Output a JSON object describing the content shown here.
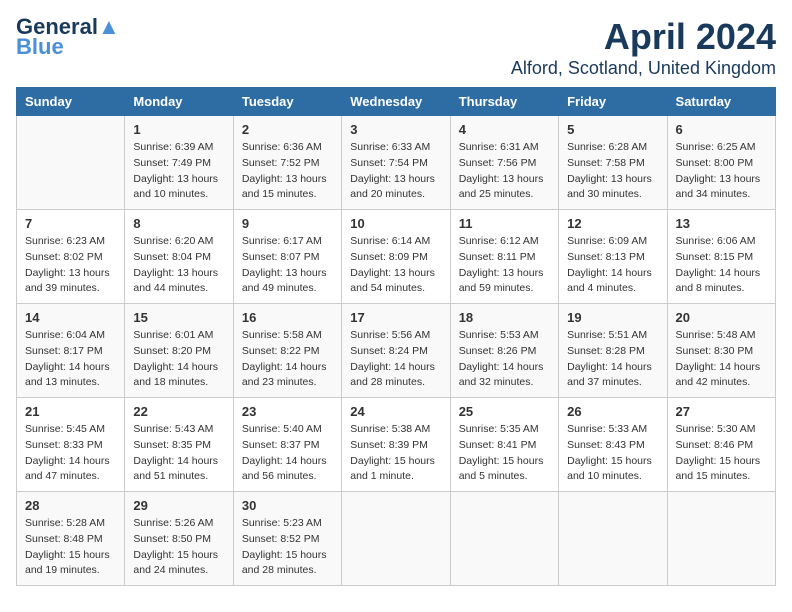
{
  "header": {
    "logo_line1": "General",
    "logo_line2": "Blue",
    "month_year": "April 2024",
    "location": "Alford, Scotland, United Kingdom"
  },
  "weekdays": [
    "Sunday",
    "Monday",
    "Tuesday",
    "Wednesday",
    "Thursday",
    "Friday",
    "Saturday"
  ],
  "weeks": [
    [
      {
        "day": "",
        "sunrise": "",
        "sunset": "",
        "daylight": ""
      },
      {
        "day": "1",
        "sunrise": "Sunrise: 6:39 AM",
        "sunset": "Sunset: 7:49 PM",
        "daylight": "Daylight: 13 hours and 10 minutes."
      },
      {
        "day": "2",
        "sunrise": "Sunrise: 6:36 AM",
        "sunset": "Sunset: 7:52 PM",
        "daylight": "Daylight: 13 hours and 15 minutes."
      },
      {
        "day": "3",
        "sunrise": "Sunrise: 6:33 AM",
        "sunset": "Sunset: 7:54 PM",
        "daylight": "Daylight: 13 hours and 20 minutes."
      },
      {
        "day": "4",
        "sunrise": "Sunrise: 6:31 AM",
        "sunset": "Sunset: 7:56 PM",
        "daylight": "Daylight: 13 hours and 25 minutes."
      },
      {
        "day": "5",
        "sunrise": "Sunrise: 6:28 AM",
        "sunset": "Sunset: 7:58 PM",
        "daylight": "Daylight: 13 hours and 30 minutes."
      },
      {
        "day": "6",
        "sunrise": "Sunrise: 6:25 AM",
        "sunset": "Sunset: 8:00 PM",
        "daylight": "Daylight: 13 hours and 34 minutes."
      }
    ],
    [
      {
        "day": "7",
        "sunrise": "Sunrise: 6:23 AM",
        "sunset": "Sunset: 8:02 PM",
        "daylight": "Daylight: 13 hours and 39 minutes."
      },
      {
        "day": "8",
        "sunrise": "Sunrise: 6:20 AM",
        "sunset": "Sunset: 8:04 PM",
        "daylight": "Daylight: 13 hours and 44 minutes."
      },
      {
        "day": "9",
        "sunrise": "Sunrise: 6:17 AM",
        "sunset": "Sunset: 8:07 PM",
        "daylight": "Daylight: 13 hours and 49 minutes."
      },
      {
        "day": "10",
        "sunrise": "Sunrise: 6:14 AM",
        "sunset": "Sunset: 8:09 PM",
        "daylight": "Daylight: 13 hours and 54 minutes."
      },
      {
        "day": "11",
        "sunrise": "Sunrise: 6:12 AM",
        "sunset": "Sunset: 8:11 PM",
        "daylight": "Daylight: 13 hours and 59 minutes."
      },
      {
        "day": "12",
        "sunrise": "Sunrise: 6:09 AM",
        "sunset": "Sunset: 8:13 PM",
        "daylight": "Daylight: 14 hours and 4 minutes."
      },
      {
        "day": "13",
        "sunrise": "Sunrise: 6:06 AM",
        "sunset": "Sunset: 8:15 PM",
        "daylight": "Daylight: 14 hours and 8 minutes."
      }
    ],
    [
      {
        "day": "14",
        "sunrise": "Sunrise: 6:04 AM",
        "sunset": "Sunset: 8:17 PM",
        "daylight": "Daylight: 14 hours and 13 minutes."
      },
      {
        "day": "15",
        "sunrise": "Sunrise: 6:01 AM",
        "sunset": "Sunset: 8:20 PM",
        "daylight": "Daylight: 14 hours and 18 minutes."
      },
      {
        "day": "16",
        "sunrise": "Sunrise: 5:58 AM",
        "sunset": "Sunset: 8:22 PM",
        "daylight": "Daylight: 14 hours and 23 minutes."
      },
      {
        "day": "17",
        "sunrise": "Sunrise: 5:56 AM",
        "sunset": "Sunset: 8:24 PM",
        "daylight": "Daylight: 14 hours and 28 minutes."
      },
      {
        "day": "18",
        "sunrise": "Sunrise: 5:53 AM",
        "sunset": "Sunset: 8:26 PM",
        "daylight": "Daylight: 14 hours and 32 minutes."
      },
      {
        "day": "19",
        "sunrise": "Sunrise: 5:51 AM",
        "sunset": "Sunset: 8:28 PM",
        "daylight": "Daylight: 14 hours and 37 minutes."
      },
      {
        "day": "20",
        "sunrise": "Sunrise: 5:48 AM",
        "sunset": "Sunset: 8:30 PM",
        "daylight": "Daylight: 14 hours and 42 minutes."
      }
    ],
    [
      {
        "day": "21",
        "sunrise": "Sunrise: 5:45 AM",
        "sunset": "Sunset: 8:33 PM",
        "daylight": "Daylight: 14 hours and 47 minutes."
      },
      {
        "day": "22",
        "sunrise": "Sunrise: 5:43 AM",
        "sunset": "Sunset: 8:35 PM",
        "daylight": "Daylight: 14 hours and 51 minutes."
      },
      {
        "day": "23",
        "sunrise": "Sunrise: 5:40 AM",
        "sunset": "Sunset: 8:37 PM",
        "daylight": "Daylight: 14 hours and 56 minutes."
      },
      {
        "day": "24",
        "sunrise": "Sunrise: 5:38 AM",
        "sunset": "Sunset: 8:39 PM",
        "daylight": "Daylight: 15 hours and 1 minute."
      },
      {
        "day": "25",
        "sunrise": "Sunrise: 5:35 AM",
        "sunset": "Sunset: 8:41 PM",
        "daylight": "Daylight: 15 hours and 5 minutes."
      },
      {
        "day": "26",
        "sunrise": "Sunrise: 5:33 AM",
        "sunset": "Sunset: 8:43 PM",
        "daylight": "Daylight: 15 hours and 10 minutes."
      },
      {
        "day": "27",
        "sunrise": "Sunrise: 5:30 AM",
        "sunset": "Sunset: 8:46 PM",
        "daylight": "Daylight: 15 hours and 15 minutes."
      }
    ],
    [
      {
        "day": "28",
        "sunrise": "Sunrise: 5:28 AM",
        "sunset": "Sunset: 8:48 PM",
        "daylight": "Daylight: 15 hours and 19 minutes."
      },
      {
        "day": "29",
        "sunrise": "Sunrise: 5:26 AM",
        "sunset": "Sunset: 8:50 PM",
        "daylight": "Daylight: 15 hours and 24 minutes."
      },
      {
        "day": "30",
        "sunrise": "Sunrise: 5:23 AM",
        "sunset": "Sunset: 8:52 PM",
        "daylight": "Daylight: 15 hours and 28 minutes."
      },
      {
        "day": "",
        "sunrise": "",
        "sunset": "",
        "daylight": ""
      },
      {
        "day": "",
        "sunrise": "",
        "sunset": "",
        "daylight": ""
      },
      {
        "day": "",
        "sunrise": "",
        "sunset": "",
        "daylight": ""
      },
      {
        "day": "",
        "sunrise": "",
        "sunset": "",
        "daylight": ""
      }
    ]
  ]
}
